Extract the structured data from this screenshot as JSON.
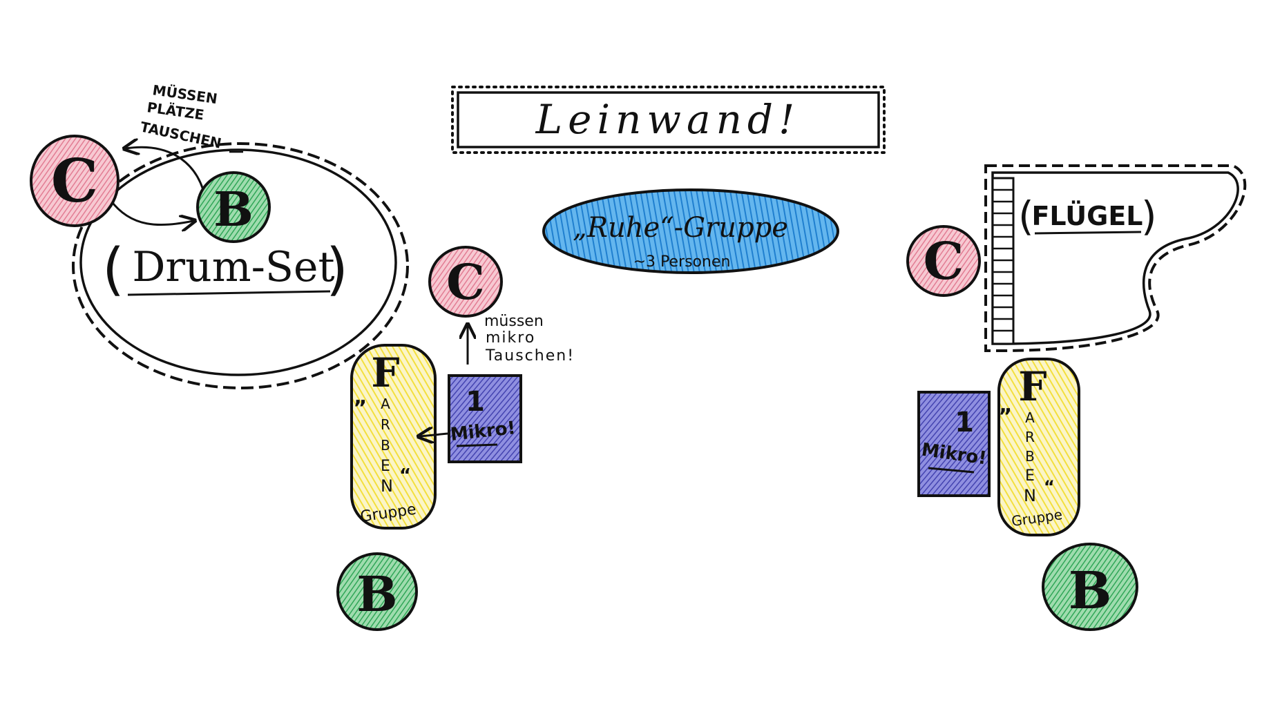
{
  "screen": {
    "title": "Leinwand!"
  },
  "drum": {
    "label": "Drum-Set",
    "note": [
      "MÜSSEN",
      "PLÄTZE",
      "TAUSCHEN"
    ]
  },
  "ruhe": {
    "label": "„Ruhe“-Gruppe",
    "sub": "~3 Personen"
  },
  "fluegel": {
    "label": "FLÜGEL"
  },
  "mikro_note": [
    "müssen",
    "mikro",
    "Tauschen!"
  ],
  "farben_group": {
    "letters": [
      "F",
      "A",
      "R",
      "B",
      "E",
      "N"
    ],
    "open_quote": "„",
    "close_quote": "“",
    "sub": "Gruppe"
  },
  "mikro_box": {
    "number": "1",
    "label": "Mikro!"
  },
  "markers": {
    "c": "C",
    "b": "B"
  },
  "colors": {
    "ink": "#111111",
    "c_fill": "#f2a7b5",
    "b_fill": "#5cc07a",
    "ruhe_fill": "#2f8fd8",
    "farben_fill": "#f7e86a",
    "mikro_fill": "#5b5bc2"
  }
}
